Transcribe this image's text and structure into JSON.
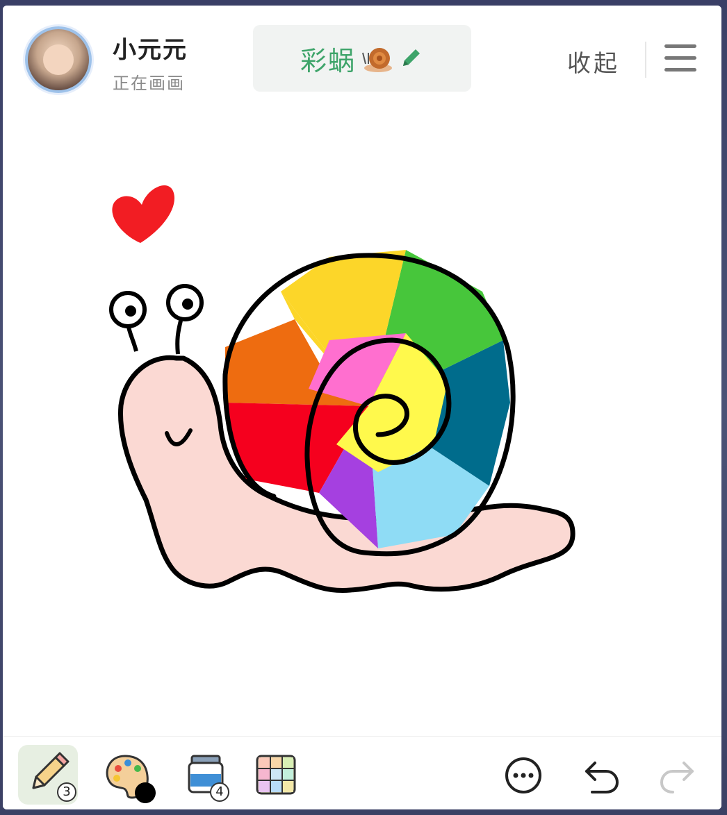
{
  "header": {
    "username": "小元元",
    "status": "正在画画",
    "title": "彩蜗",
    "collapse_label": "收起"
  },
  "toolbar": {
    "pencil_count": "3",
    "bucket_count": "4",
    "current_color": "#000000"
  },
  "colors": {
    "title_green": "#3ea46a",
    "active_tool_bg": "#e7efe2"
  }
}
